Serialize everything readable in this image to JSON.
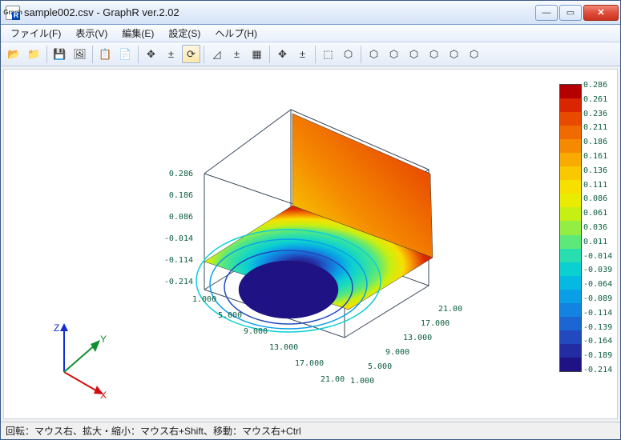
{
  "window": {
    "title": "sample002.csv - GraphR ver.2.02",
    "app_icon_text": "Graph"
  },
  "win_buttons": {
    "minimize": "—",
    "maximize": "▭",
    "close": "✕"
  },
  "menus": {
    "file": "ファイル(F)",
    "view": "表示(V)",
    "edit": "編集(E)",
    "settings": "設定(S)",
    "help": "ヘルプ(H)"
  },
  "toolbar": {
    "open": "📂",
    "recent": "📁",
    "save": "💾",
    "screenshot": "🖼",
    "copy": "📋",
    "form": "📄",
    "move": "✥",
    "zoom1": "±",
    "rotate": "⟳",
    "axis_cfg": "◿",
    "plus_alt": "±",
    "grid": "▦",
    "plus2": "✥",
    "plus3": "±",
    "reset_view": "⬚",
    "cube1": "⬡",
    "cube_xy": "⬡",
    "cube_xz": "⬡",
    "cube_yz": "⬡",
    "cube_mxy": "⬡",
    "cube_mxz": "⬡",
    "cube_myz": "⬡"
  },
  "axis_labels": {
    "x": "X",
    "y": "Y",
    "z": "Z"
  },
  "statusbar": "回転：マウス右、拡大・縮小：マウス右+Shift、移動：マウス右+Ctrl",
  "chart_data": {
    "type": "3d-surface",
    "z_axis_ticks": [
      "0.286",
      "0.186",
      "0.086",
      "-0.014",
      "-0.114",
      "-0.214"
    ],
    "x_axis_ticks": [
      "1.000",
      "5.000",
      "9.000",
      "13.000",
      "17.000",
      "21.00"
    ],
    "y_axis_ticks": [
      "1.000",
      "5.000",
      "9.000",
      "13.000",
      "17.000",
      "21.00"
    ],
    "xlim": [
      1.0,
      21.0
    ],
    "ylim": [
      1.0,
      21.0
    ],
    "zlim": [
      -0.214,
      0.286
    ],
    "colorscale_values": [
      "0.286",
      "0.261",
      "0.236",
      "0.211",
      "0.186",
      "0.161",
      "0.136",
      "0.111",
      "0.086",
      "0.061",
      "0.036",
      "0.011",
      "-0.014",
      "-0.039",
      "-0.064",
      "-0.089",
      "-0.114",
      "-0.139",
      "-0.164",
      "-0.189",
      "-0.214"
    ],
    "colorscale_colors": [
      "#b40000",
      "#d92500",
      "#e84a00",
      "#f06a00",
      "#f58a00",
      "#f8aa00",
      "#f9c800",
      "#f7e000",
      "#e9ec00",
      "#c6ef14",
      "#94ed43",
      "#5de87a",
      "#29deae",
      "#0ccfd2",
      "#05b9e2",
      "#0a9fe6",
      "#1283e0",
      "#1b66d2",
      "#2249bd",
      "#242ca1",
      "#1f1285"
    ],
    "description": "Rainbow-colored 3D surface with a deep blue funnel/well near the center-front descending to about -0.214, rising to a red ridge near the back edge at about 0.286. Concentric color bands indicate smooth height variation."
  }
}
